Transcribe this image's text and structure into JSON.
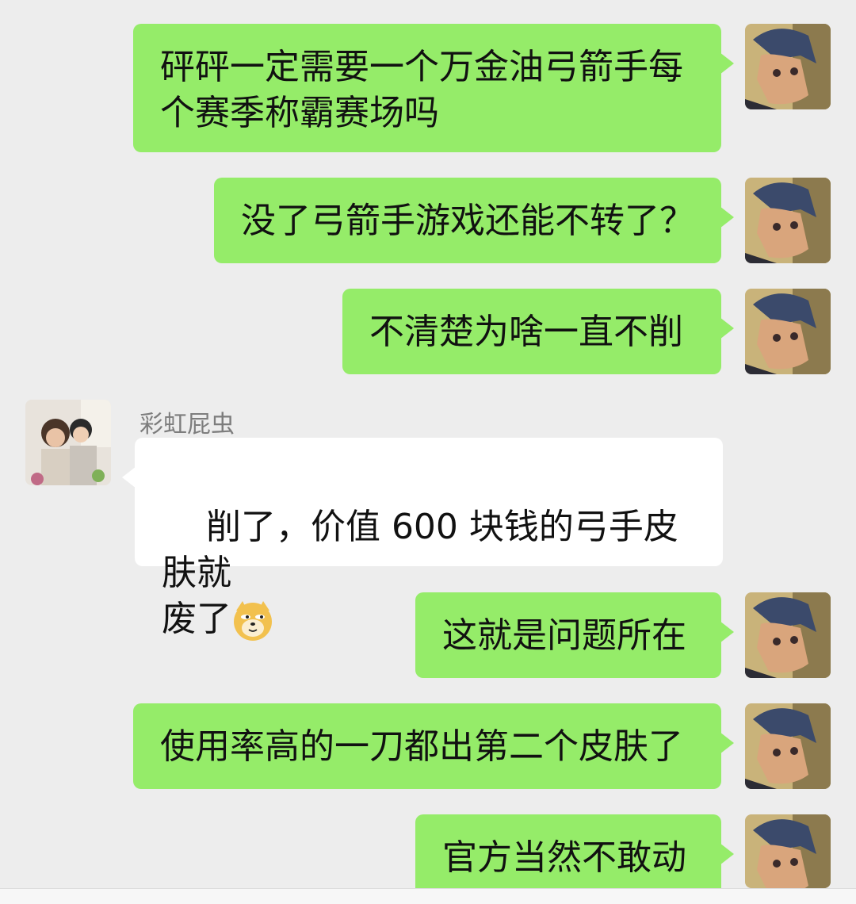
{
  "messages": [
    {
      "side": "me",
      "text": "砰砰一定需要一个万金油弓箭手每\n个赛季称霸赛场吗"
    },
    {
      "side": "me",
      "text": "没了弓箭手游戏还能不转了？"
    },
    {
      "side": "me",
      "text": "不清楚为啥一直不削"
    },
    {
      "side": "other",
      "sender": "彩虹屁虫",
      "text_line1": "削了，价值 600 块钱的弓手皮肤就",
      "text_line2": "废了",
      "emoji": "doge-emoji"
    },
    {
      "side": "me",
      "text": "这就是问题所在"
    },
    {
      "side": "me",
      "text": "使用率高的一刀都出第二个皮肤了"
    },
    {
      "side": "me",
      "text": "官方当然不敢动"
    }
  ],
  "colors": {
    "me_bubble": "#95ec69",
    "other_bubble": "#ffffff",
    "background": "#ededed"
  }
}
